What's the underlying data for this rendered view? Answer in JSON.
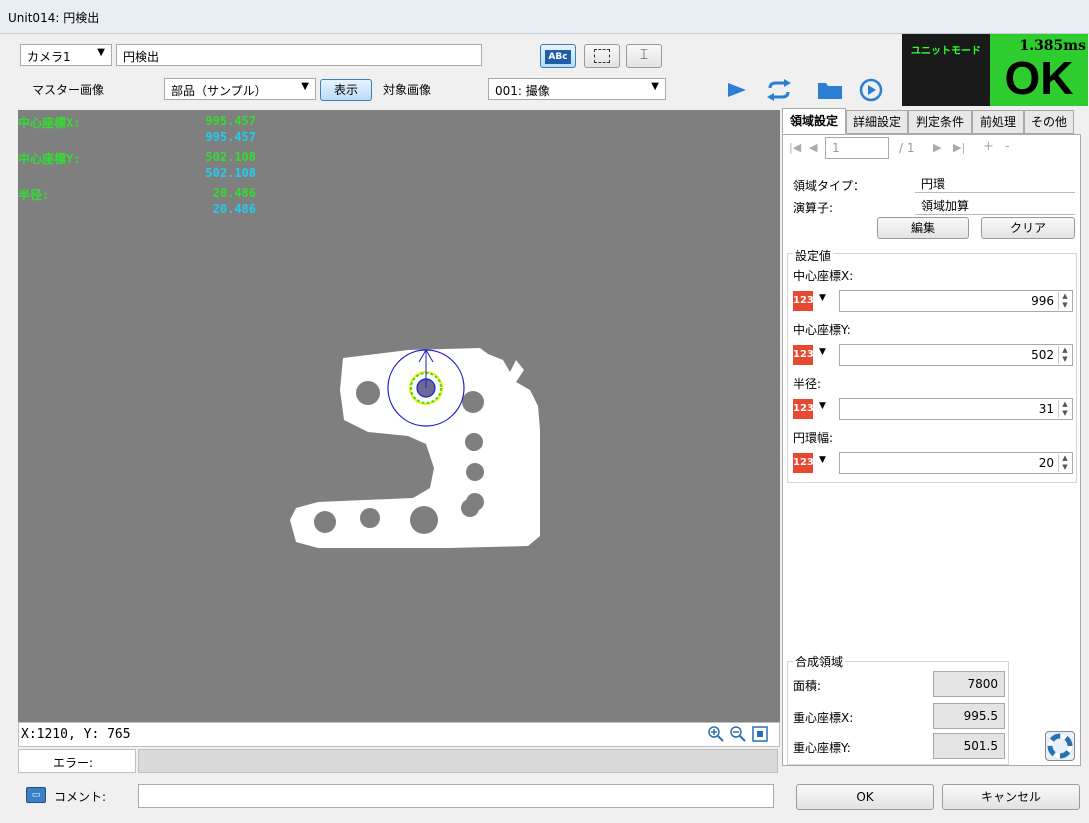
{
  "window": {
    "title": "Unit014: 円検出"
  },
  "toolbar": {
    "camera_select": "カメラ1",
    "unit_name": "円検出",
    "master_label": "マスター画像",
    "master_select": "部品（サンプル）",
    "show_button": "表示",
    "target_label": "対象画像",
    "target_select": "001: 撮像",
    "abc_icon_text": "ABc"
  },
  "status_panel": {
    "mode": "ユニットモード",
    "time": "1.385ms",
    "result": "OK"
  },
  "overlay": {
    "rows": [
      {
        "label": "中心座標X:",
        "v1": "995.457",
        "v2": "995.457"
      },
      {
        "label": "中心座標Y:",
        "v1": "502.108",
        "v2": "502.108"
      },
      {
        "label": "半径:",
        "v1": "20.486",
        "v2": "20.486"
      }
    ]
  },
  "canvas_status": {
    "coords": "X:1210, Y: 765"
  },
  "bottom": {
    "error_label": "エラー:",
    "comment_label": "コメント:",
    "ok_button": "OK",
    "cancel_button": "キャンセル"
  },
  "tabs": [
    "領域設定",
    "詳細設定",
    "判定条件",
    "前処理",
    "その他"
  ],
  "nav": {
    "page": "1",
    "total": "/ 1",
    "add": "+",
    "remove": "-"
  },
  "region": {
    "type_label": "領域タイプ：",
    "type_value": "円環",
    "op_label": "演算子:",
    "op_value": "領域加算",
    "edit_button": "編集",
    "clear_button": "クリア"
  },
  "settings": {
    "group_label": "設定値",
    "fields": [
      {
        "label": "中心座標X:",
        "value": "996"
      },
      {
        "label": "中心座標Y:",
        "value": "502"
      },
      {
        "label": "半径:",
        "value": "31"
      },
      {
        "label": "円環幅:",
        "value": "20"
      }
    ],
    "icon_text": "123"
  },
  "composite": {
    "group_label": "合成領域",
    "rows": [
      {
        "label": "面積:",
        "value": "7800"
      },
      {
        "label": "重心座標X:",
        "value": "995.5"
      },
      {
        "label": "重心座標Y:",
        "value": "501.5"
      }
    ]
  },
  "colors": {
    "ok_green": "#2ecc2e",
    "accent_blue": "#2a7fd4",
    "overlay_green": "#33dd33",
    "overlay_cyan": "#22ccee"
  }
}
